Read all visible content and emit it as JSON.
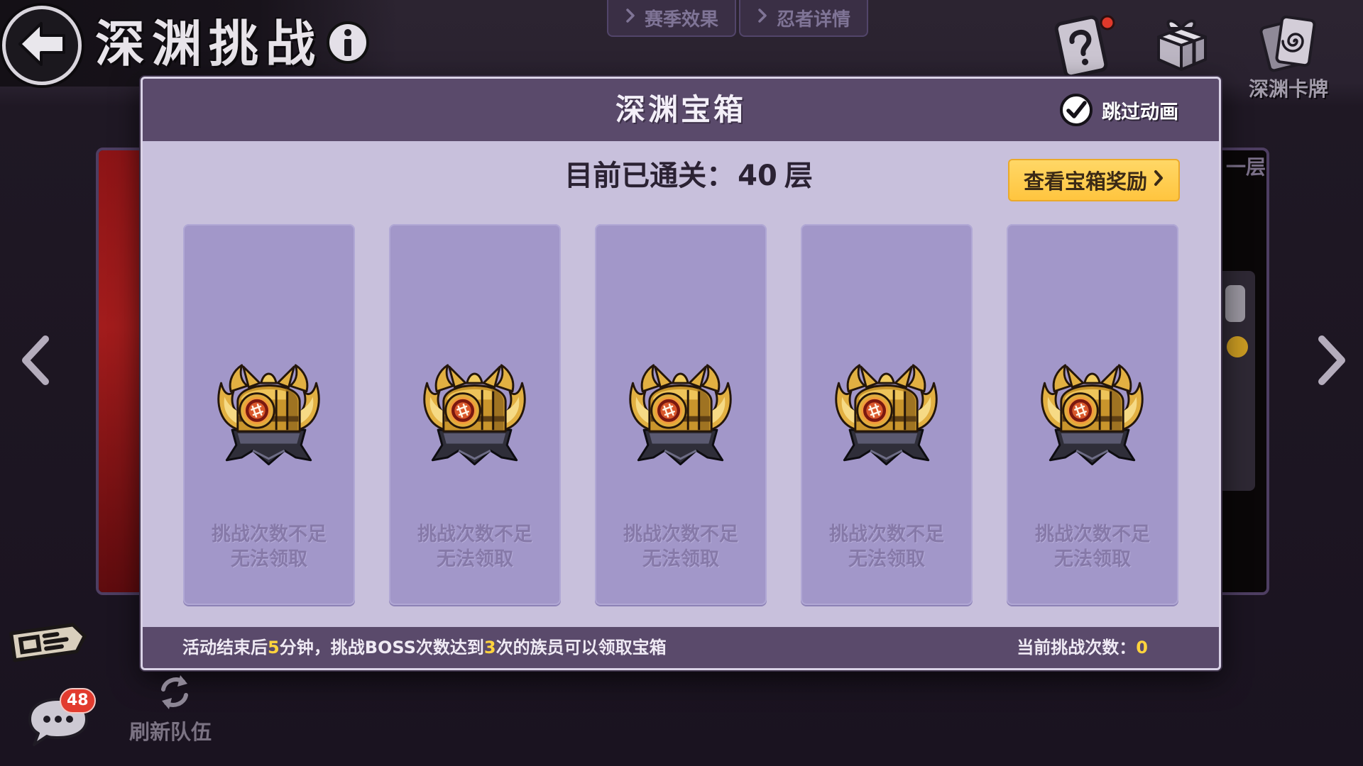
{
  "top_bar": {
    "title": "深渊挑战",
    "back_icon": "back-arrow-icon",
    "info_icon": "info-icon",
    "tabs": [
      {
        "label": "赛季效果",
        "icon": "chevron-right-icon"
      },
      {
        "label": "忍者详情",
        "icon": "chevron-right-icon"
      }
    ],
    "right_icons": [
      {
        "icon": "help-card-icon",
        "has_red_dot": true
      },
      {
        "icon": "gift-box-icon"
      },
      {
        "icon": "abyss-card-icon",
        "label": "深渊卡牌"
      }
    ]
  },
  "stage_panel": {
    "floor_hint": "一层",
    "prev_icon": "chevron-left-icon",
    "next_icon": "chevron-right-icon"
  },
  "bottom_left": {
    "sign_icon": "signboard-icon",
    "chat_icon": "chat-bubble-icon",
    "chat_unread": "48",
    "refresh_icon": "refresh-icon",
    "refresh_label": "刷新队伍"
  },
  "modal": {
    "title": "深渊宝箱",
    "skip_animation": {
      "label": "跳过动画",
      "checked": true
    },
    "progress": {
      "label": "目前已通关：",
      "floors": "40",
      "unit": "层"
    },
    "view_rewards_label": "查看宝箱奖励",
    "chests": [
      {
        "icon": "treasure-chest-icon",
        "status_line1": "挑战次数不足",
        "status_line2": "无法领取"
      },
      {
        "icon": "treasure-chest-icon",
        "status_line1": "挑战次数不足",
        "status_line2": "无法领取"
      },
      {
        "icon": "treasure-chest-icon",
        "status_line1": "挑战次数不足",
        "status_line2": "无法领取"
      },
      {
        "icon": "treasure-chest-icon",
        "status_line1": "挑战次数不足",
        "status_line2": "无法领取"
      },
      {
        "icon": "treasure-chest-icon",
        "status_line1": "挑战次数不足",
        "status_line2": "无法领取"
      }
    ],
    "footer": {
      "rule_text_1": "活动结束后",
      "rule_minutes": "5",
      "rule_text_2": "分钟，挑战BOSS次数达到",
      "rule_required_count": "3",
      "rule_text_3": "次的族员可以领取宝箱",
      "challenge_count_label": "当前挑战次数：",
      "challenge_count": "0"
    }
  },
  "colors": {
    "modal_header": "#5a4a6b",
    "modal_body": "#c8c0dc",
    "card": "#a297c9",
    "card_text": "#8679a8",
    "accent_yellow": "#ffd33d",
    "button_yellow": "#ffc94d",
    "notification_red": "#e23b2e"
  }
}
